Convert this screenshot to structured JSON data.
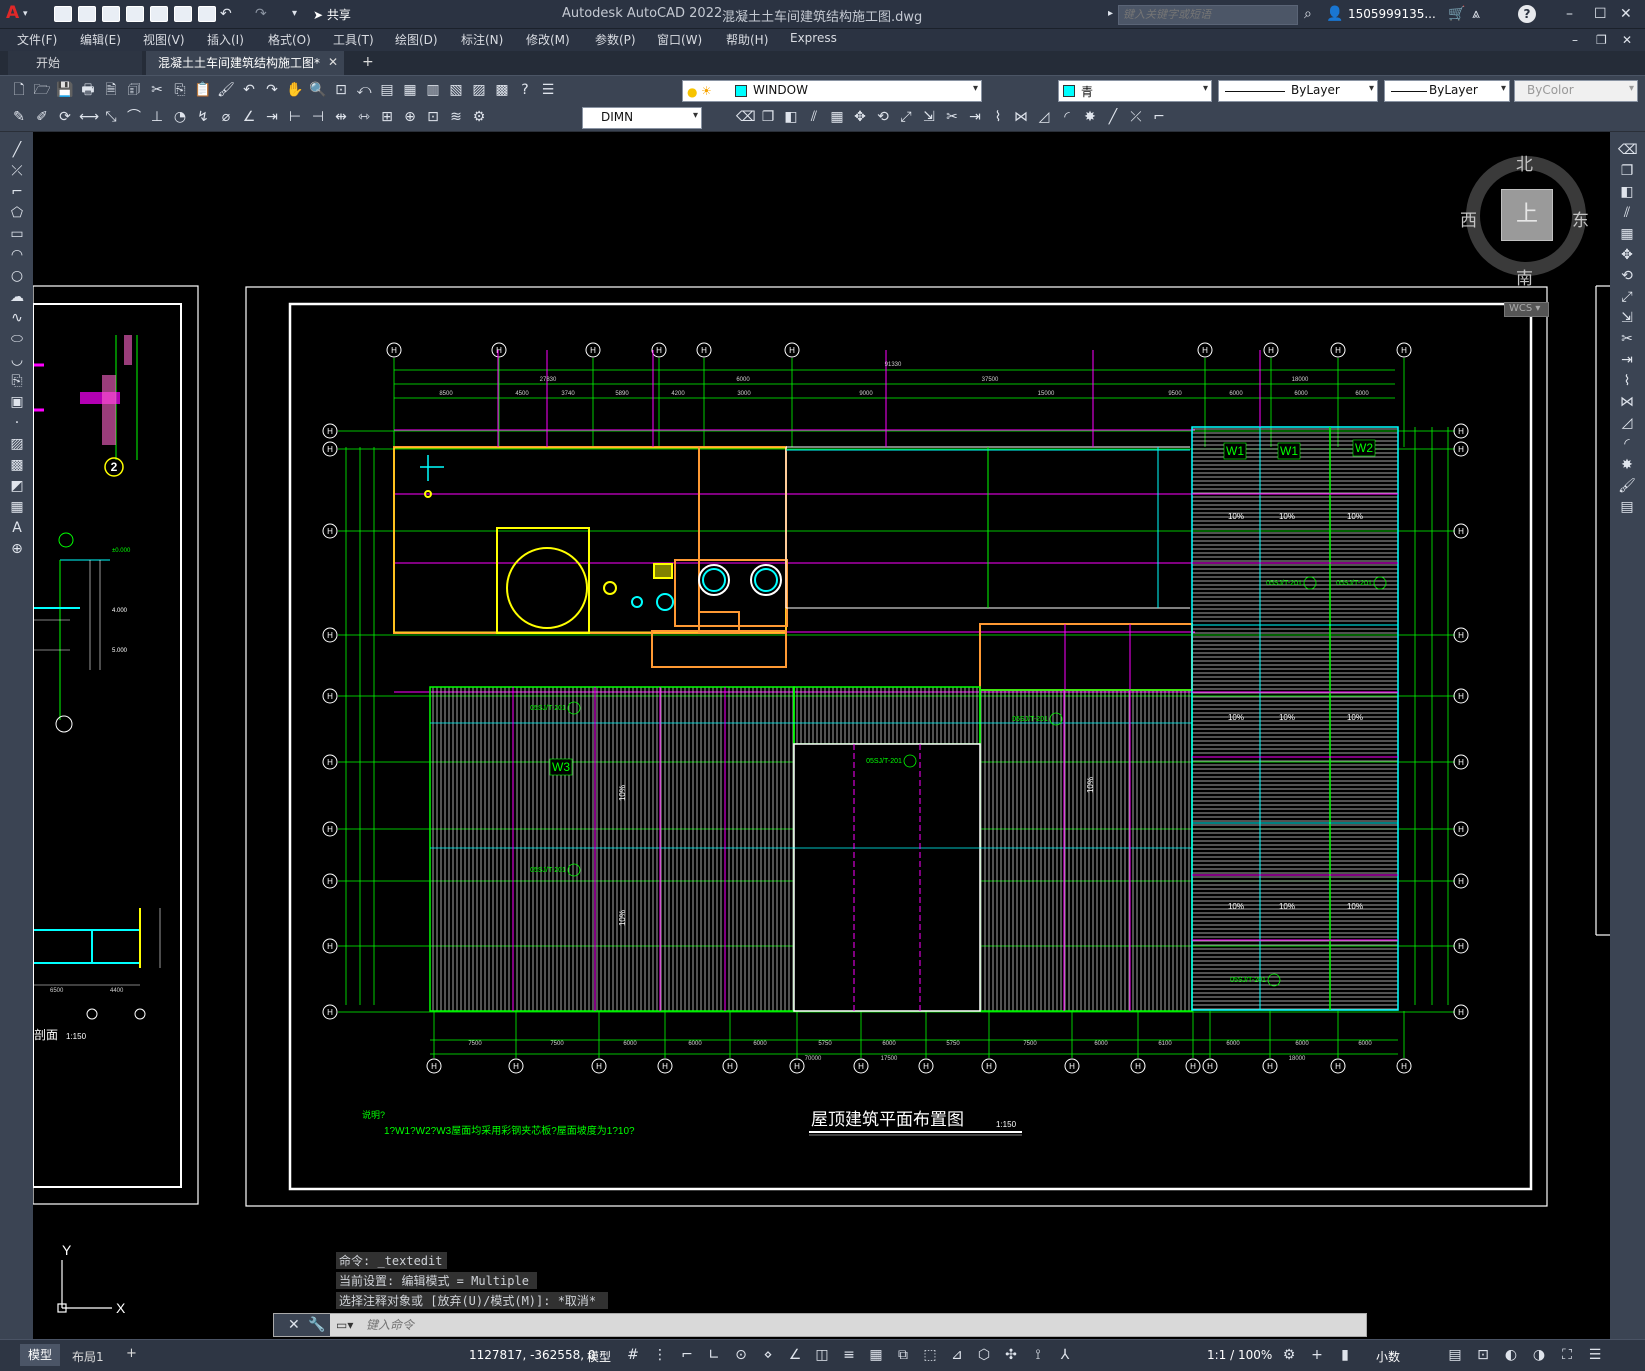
{
  "app": {
    "title": "Autodesk AutoCAD 2022",
    "file": "混凝土土车间建筑结构施工图.dwg",
    "logo": "A",
    "share": "共享",
    "search_placeholder": "键入关键字或短语",
    "user": "1505999135...",
    "help": "?"
  },
  "menu": [
    "文件(F)",
    "编辑(E)",
    "视图(V)",
    "插入(I)",
    "格式(O)",
    "工具(T)",
    "绘图(D)",
    "标注(N)",
    "修改(M)",
    "参数(P)",
    "窗口(W)",
    "帮助(H)",
    "Express"
  ],
  "tabs": {
    "start": "开始",
    "active": "混凝土土车间建筑结构施工图*",
    "close": "✕",
    "add": "+"
  },
  "toolbar": {
    "layer_value": "WINDOW",
    "color_value": "青",
    "linetype_value": "ByLayer",
    "lineweight_value": "ByLayer",
    "plotstyle_value": "ByColor",
    "dimstyle_value": "DIMN"
  },
  "viewcube": {
    "north": "北",
    "south": "南",
    "east": "东",
    "west": "西",
    "top": "上",
    "wcs": "WCS"
  },
  "drawing": {
    "title": "屋顶建筑平面布置图",
    "scale": "1:150",
    "note_heading": "说明?",
    "note_line": "1?W1?W2?W3屋面均采用彩钢夹芯板?屋面坡度为1?10?",
    "roof_labels": [
      "W1",
      "W1",
      "W2",
      "W3"
    ],
    "slopes": [
      "10%",
      "10%",
      "10%",
      "10%",
      "10%",
      "10%",
      "10%",
      "10%",
      "10%",
      "10%",
      "10%",
      "10%"
    ],
    "detail_refs": [
      "05SJ/T-201",
      "05SJ/T-201",
      "05SJ/T-201",
      "05SJ/T-201",
      "05SJ/T-201",
      "05SJ/T-201",
      "05SJ/T-201"
    ],
    "dims_top_total": "91330",
    "dims_top_row1": [
      "27830",
      "",
      "6000",
      "",
      "37500",
      "",
      "",
      "18000"
    ],
    "dims_top_row2": [
      "8500",
      "4500",
      "3740",
      "5890",
      "4200",
      "3000",
      "9000",
      "15000",
      "9500",
      "6000",
      "6000",
      "6000"
    ],
    "dims_bottom_row1": [
      "7500",
      "7500",
      "6000",
      "6000",
      "6000",
      "5750",
      "6000",
      "5750",
      "7500",
      "6000",
      "6100",
      "6000",
      "6000",
      "6000"
    ],
    "dims_bottom_row2": [
      "70000",
      "17500",
      "18000"
    ],
    "grid_top": [
      "⑪",
      "⑫",
      "⑬",
      "⑭",
      "⑮",
      "⑯",
      "⑰",
      "⑱",
      "⑲",
      "⑳"
    ],
    "left_detail_num": "2",
    "left_section_label": "剖面",
    "left_section_scale": "1:150",
    "left_dims": [
      "6500",
      "4400"
    ],
    "left_levels": [
      "±0.000",
      "4.000",
      "5.000"
    ]
  },
  "command": {
    "lines": [
      "命令: _textedit",
      "当前设置: 编辑模式 = Multiple",
      "选择注释对象或 [放弃(U)/模式(M)]: *取消*"
    ],
    "placeholder": "键入命令"
  },
  "ucs": {
    "y": "Y",
    "x": "X"
  },
  "layout_tabs": [
    "模型",
    "布局1",
    "+"
  ],
  "status": {
    "coords": "1127817, -362558, 0",
    "model": "模型",
    "scale": "1:1 / 100%",
    "units": "小数"
  },
  "colors": {
    "bg": "#000000",
    "chrome": "#3b4453",
    "grid": "#00ff00",
    "dim": "#ffffff",
    "wall": "#ff9933",
    "magenta": "#ff00ff",
    "cyan": "#00ffff",
    "yellow": "#ffff00"
  }
}
